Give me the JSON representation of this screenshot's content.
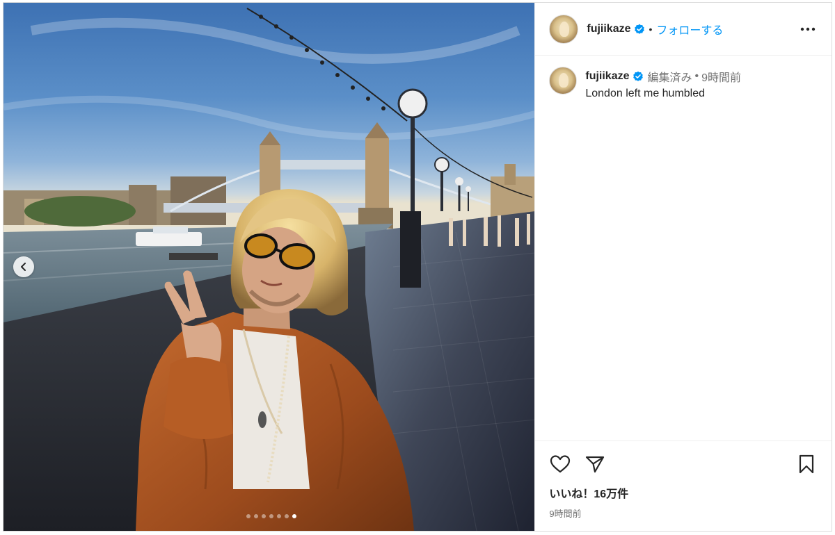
{
  "post": {
    "username": "fujiikaze",
    "follow_label": "フォローする",
    "separator": "•",
    "caption": {
      "edited_label": "編集済み",
      "separator": "•",
      "time_ago": "9時間前",
      "text": "London left me humbled"
    },
    "likes_label": "いいね！16万件",
    "timestamp": "9時間前"
  },
  "carousel": {
    "total_slides": 7,
    "active_slide": 7
  },
  "icons": {
    "verified": "verified-badge-icon",
    "more": "more-options-icon",
    "like": "heart-icon",
    "share": "share-icon",
    "save": "bookmark-icon",
    "prev": "chevron-left-icon"
  },
  "colors": {
    "link": "#0095f6",
    "verified": "#0095f6",
    "muted": "#737373",
    "text": "#262626"
  }
}
